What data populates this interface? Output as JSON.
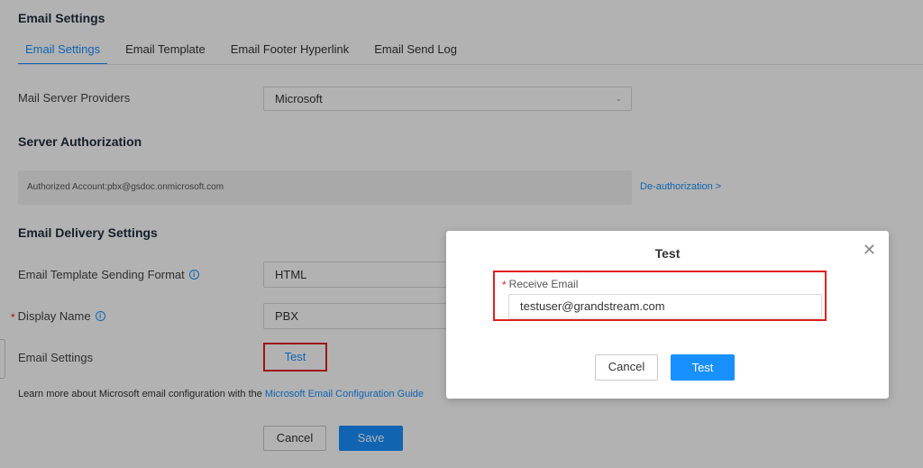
{
  "page": {
    "title": "Email Settings"
  },
  "tabs": [
    {
      "label": "Email Settings",
      "active": true
    },
    {
      "label": "Email Template",
      "active": false
    },
    {
      "label": "Email Footer Hyperlink",
      "active": false
    },
    {
      "label": "Email Send Log",
      "active": false
    }
  ],
  "mail_server": {
    "label": "Mail Server Providers",
    "value": "Microsoft"
  },
  "server_auth": {
    "title": "Server Authorization",
    "account_text": "Authorized Account:pbx@gsdoc.onmicrosoft.com",
    "deauth_label": "De-authorization >"
  },
  "delivery": {
    "title": "Email Delivery Settings",
    "format_label": "Email Template Sending Format",
    "format_value": "HTML",
    "display_name_label": "Display Name",
    "display_name_value": "PBX",
    "email_settings_label": "Email Settings",
    "test_label": "Test",
    "learn_text": "Learn more about Microsoft email configuration with the ",
    "learn_link": "Microsoft Email Configuration Guide"
  },
  "footer": {
    "cancel_label": "Cancel",
    "save_label": "Save"
  },
  "modal": {
    "title": "Test",
    "close_glyph": "✕",
    "field_label": "Receive Email",
    "field_value": "testuser@grandstream.com",
    "cancel_label": "Cancel",
    "test_label": "Test"
  },
  "icons": {
    "required": "*",
    "info": "i",
    "chevron": "⌄"
  },
  "colors": {
    "accent": "#1890ff",
    "highlight_border": "#e02020"
  }
}
